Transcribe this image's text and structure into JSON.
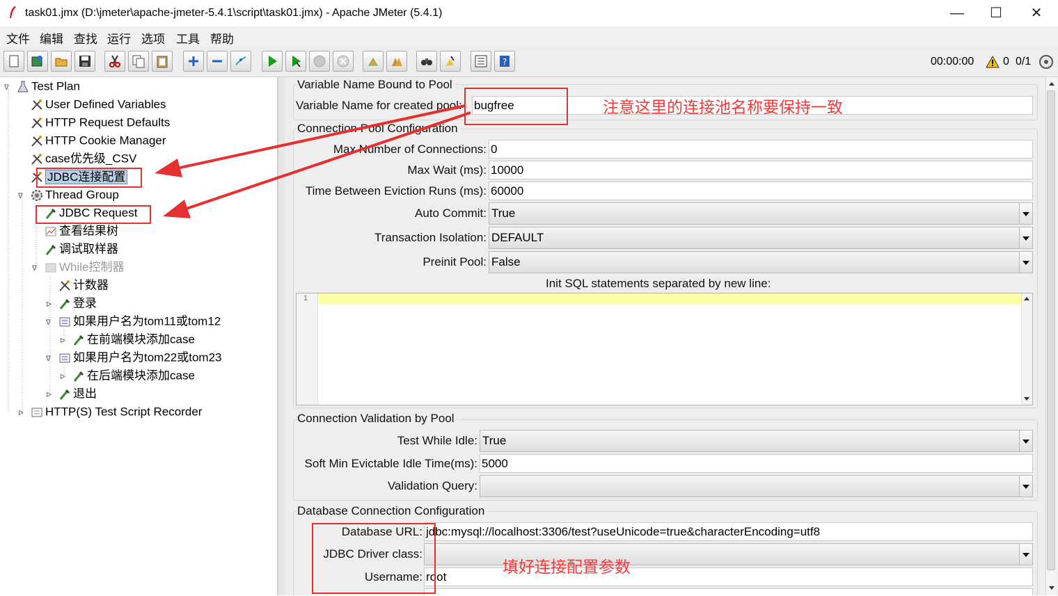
{
  "window": {
    "title": "task01.jmx (D:\\jmeter\\apache-jmeter-5.4.1\\script\\task01.jmx) - Apache JMeter (5.4.1)",
    "minimize": "—",
    "maximize": "☐",
    "close": "✕"
  },
  "menu": [
    "文件",
    "编辑",
    "查找",
    "运行",
    "选项",
    "工具",
    "帮助"
  ],
  "status": {
    "timer": "00:00:00",
    "warnings": "0",
    "threads": "0/1"
  },
  "tree": [
    {
      "label": "Test Plan",
      "icon": "test-plan-icon"
    },
    {
      "label": "User Defined Variables",
      "icon": "config-element-icon"
    },
    {
      "label": "HTTP Request Defaults",
      "icon": "config-element-icon"
    },
    {
      "label": "HTTP Cookie Manager",
      "icon": "config-element-icon"
    },
    {
      "label": "case优先级_CSV",
      "icon": "config-element-icon"
    },
    {
      "label": "JDBC连接配置",
      "icon": "config-element-icon",
      "selected": true
    },
    {
      "label": "Thread Group",
      "icon": "gear-icon"
    },
    {
      "label": "JDBC Request",
      "icon": "sampler-icon"
    },
    {
      "label": "查看结果树",
      "icon": "listener-icon"
    },
    {
      "label": "调试取样器",
      "icon": "sampler-icon"
    },
    {
      "label": "While控制器",
      "icon": "controller-icon",
      "disabled": true
    },
    {
      "label": "计数器",
      "icon": "config-element-icon"
    },
    {
      "label": "登录",
      "icon": "sampler-icon"
    },
    {
      "label": "如果用户名为tom11或tom12",
      "icon": "controller-icon"
    },
    {
      "label": "在前端模块添加case",
      "icon": "sampler-icon"
    },
    {
      "label": "如果用户名为tom22或tom23",
      "icon": "controller-icon"
    },
    {
      "label": "在后端模块添加case",
      "icon": "sampler-icon"
    },
    {
      "label": "退出",
      "icon": "sampler-icon"
    },
    {
      "label": "HTTP(S) Test Script Recorder",
      "icon": "recorder-icon"
    }
  ],
  "form": {
    "pool_section": "Variable Name Bound to Pool",
    "pool_name_label": "Variable Name for created pool:",
    "pool_name_value": "bugfree",
    "conn_section": "Connection Pool Configuration",
    "max_conn_label": "Max Number of Connections:",
    "max_conn_value": "0",
    "max_wait_label": "Max Wait (ms):",
    "max_wait_value": "10000",
    "eviction_label": "Time Between Eviction Runs (ms):",
    "eviction_value": "60000",
    "auto_commit_label": "Auto Commit:",
    "auto_commit_value": "True",
    "isolation_label": "Transaction Isolation:",
    "isolation_value": "DEFAULT",
    "preinit_label": "Preinit Pool:",
    "preinit_value": "False",
    "init_sql_label": "Init SQL statements separated by new line:",
    "init_sql_line": "1",
    "validation_section": "Connection Validation by Pool",
    "test_idle_label": "Test While Idle:",
    "test_idle_value": "True",
    "soft_min_label": "Soft Min Evictable Idle Time(ms):",
    "soft_min_value": "5000",
    "validation_query_label": "Validation Query:",
    "validation_query_value": "",
    "db_section": "Database Connection Configuration",
    "db_url_label": "Database URL:",
    "db_url_value": "jdbc:mysql://localhost:3306/test?useUnicode=true&characterEncoding=utf8",
    "driver_label": "JDBC Driver class:",
    "driver_value": "",
    "username_label": "Username:",
    "username_value": "root"
  },
  "annotations": {
    "pool_note": "注意这里的连接池名称要保持一致",
    "config_note": "填好连接配置参数"
  },
  "colors": {
    "annotation_red": "#e03030",
    "selection": "#b8cfe5",
    "current_line": "#ffffa8"
  }
}
